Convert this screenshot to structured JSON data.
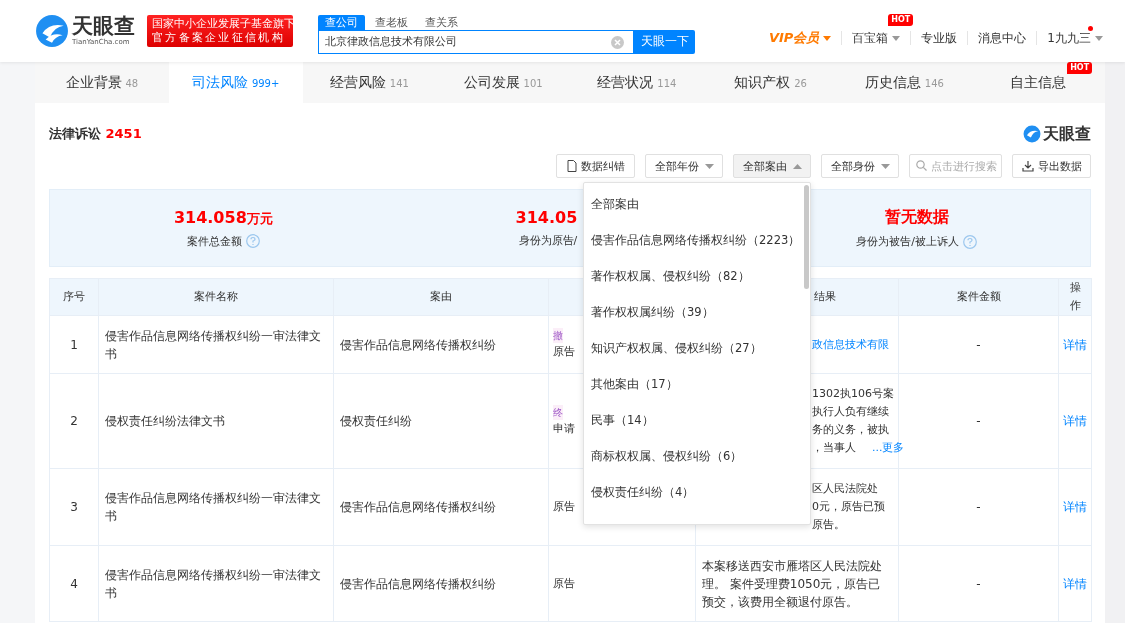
{
  "header": {
    "logo": "天眼查",
    "logo_sub": "TianYanCha.com",
    "banner": [
      "国家中小企业发展子基金旗下",
      "官方备案企业征信机构"
    ],
    "search_tabs": [
      {
        "label": "查公司",
        "selected": true
      },
      {
        "label": "查老板",
        "selected": false
      },
      {
        "label": "查关系",
        "selected": false
      }
    ],
    "search": {
      "value": "北京律政信息技术有限公司"
    },
    "search_button": "天眼一下",
    "nav": [
      {
        "label": "VIP会员",
        "kind": "vip"
      },
      {
        "label": "百宝箱",
        "kind": "menu",
        "badge": "HOT"
      },
      {
        "label": "专业版",
        "kind": "link"
      },
      {
        "label": "消息中心",
        "kind": "link"
      },
      {
        "label": "1九九三",
        "kind": "user",
        "dot": true
      }
    ]
  },
  "tabs": [
    {
      "label": "企业背景",
      "count": "48",
      "selected": false
    },
    {
      "label": "司法风险",
      "count": "999+",
      "selected": true
    },
    {
      "label": "经营风险",
      "count": "141",
      "selected": false
    },
    {
      "label": "公司发展",
      "count": "101",
      "selected": false
    },
    {
      "label": "经营状况",
      "count": "114",
      "selected": false
    },
    {
      "label": "知识产权",
      "count": "26",
      "selected": false
    },
    {
      "label": "历史信息",
      "count": "146",
      "selected": false
    },
    {
      "label": "自主信息",
      "badge": "HOT",
      "selected": false
    }
  ],
  "section": {
    "title": "法律诉讼",
    "count": "2451",
    "brand": "天眼查"
  },
  "filters": [
    {
      "kind": "button",
      "label": "数据纠错"
    },
    {
      "kind": "select",
      "label": "全部年份",
      "expanded": false
    },
    {
      "kind": "select",
      "label": "全部案由",
      "expanded": true,
      "options": [
        "全部案由",
        "侵害作品信息网络传播权纠纷（2223）",
        "著作权权属、侵权纠纷（82）",
        "著作权权属纠纷（39）",
        "知识产权权属、侵权纠纷（27）",
        "其他案由（17）",
        "民事（14）",
        "商标权权属、侵权纠纷（6）",
        "侵权责任纠纷（4）"
      ]
    },
    {
      "kind": "select",
      "label": "全部身份",
      "expanded": false
    },
    {
      "kind": "search",
      "placeholder": "点击进行搜索"
    },
    {
      "kind": "export",
      "label": "导出数据"
    }
  ],
  "stats": [
    {
      "value": "314.058",
      "unit": "万元",
      "label": "案件总金额",
      "help": true
    },
    {
      "value": "314.05",
      "label": "身份为原告/",
      "help": false
    },
    {
      "value": "暂无数据",
      "label": "身份为被告/被上诉人",
      "help": true
    }
  ],
  "table": {
    "columns": [
      "序号",
      "案件名称",
      "案由",
      "结果",
      "案件金额",
      "操作"
    ],
    "rows": [
      {
        "no": "1",
        "name": "侵害作品信息网络传播权纠纷一审法律文书",
        "cause": "侵害作品信息网络传播权纠纷",
        "tag": "撤",
        "role": "原告",
        "result": [
          "政信息技术有限"
        ],
        "result_link": true,
        "amount": "-",
        "action": "详情"
      },
      {
        "no": "2",
        "name": "侵权责任纠纷法律文书",
        "cause": "侵权责任纠纷",
        "tag": "终",
        "role": "申请",
        "result": [
          "1302执106号案",
          "执行人负有继续",
          "务的义务，被执",
          "，当事人"
        ],
        "result_link": false,
        "more": "...更多",
        "amount": "-",
        "action": "详情"
      },
      {
        "no": "3",
        "name": "侵害作品信息网络传播权纠纷一审法律文书",
        "cause": "侵害作品信息网络传播权纠纷",
        "role": "原告",
        "result": [
          "区人民法院处",
          "0元，原告已预",
          "原告。"
        ],
        "result_link": false,
        "amount": "-",
        "action": "详情"
      },
      {
        "no": "4",
        "name": "侵害作品信息网络传播权纠纷一审法律文书",
        "cause": "侵害作品信息网络传播权纠纷",
        "role": "原告",
        "full_result": "本案移送西安市雁塔区人民法院处理。 案件受理费1050元，原告已预交，该费用全额退付原告。",
        "amount": "-",
        "action": "详情"
      }
    ]
  }
}
